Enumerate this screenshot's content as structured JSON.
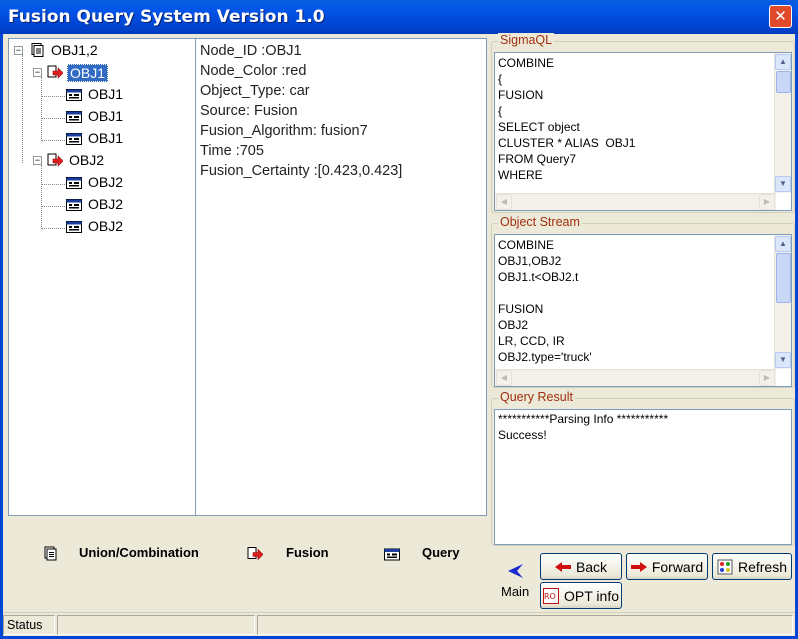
{
  "window": {
    "title": "Fusion Query System Version 1.0",
    "close_glyph": "✕"
  },
  "tree": {
    "root": {
      "label": "OBJ1,2",
      "icon": "union-icon"
    },
    "nodes": [
      {
        "label": "OBJ1",
        "icon": "fusion-icon",
        "selected": true,
        "children": [
          "OBJ1",
          "OBJ1",
          "OBJ1"
        ]
      },
      {
        "label": "OBJ2",
        "icon": "fusion-icon",
        "selected": false,
        "children": [
          "OBJ2",
          "OBJ2",
          "OBJ2"
        ]
      }
    ],
    "expander_glyph": "−"
  },
  "details": [
    "Node_ID :OBJ1",
    "Node_Color :red",
    "Object_Type: car",
    "Source: Fusion",
    "Fusion_Algorithm: fusion7",
    "Time :705",
    "Fusion_Certainty :[0.423,0.423]"
  ],
  "sigmaql": {
    "title": "SigmaQL",
    "lines": [
      "COMBINE",
      "{",
      "FUSION",
      "{",
      "SELECT object",
      "CLUSTER * ALIAS  OBJ1",
      "FROM Query7",
      "WHERE"
    ]
  },
  "object_stream": {
    "title": "Object Stream",
    "lines": [
      "COMBINE",
      "OBJ1,OBJ2",
      "OBJ1.t<OBJ2.t",
      "",
      "FUSION",
      "OBJ2",
      "LR, CCD, IR",
      "OBJ2.type='truck'"
    ]
  },
  "query_result": {
    "title": "Query Result",
    "lines": [
      "***********Parsing Info ***********",
      "Success!"
    ]
  },
  "nav": {
    "union": "Union/Combination",
    "fusion": "Fusion",
    "query": "Query",
    "main": "Main"
  },
  "buttons": {
    "back": "Back",
    "forward": "Forward",
    "refresh": "Refresh",
    "opt_info": "OPT info"
  },
  "status": {
    "label": "Status"
  },
  "colors": {
    "titlebar": "#0046d4",
    "selection": "#316ac5",
    "group_title": "#a03010"
  }
}
